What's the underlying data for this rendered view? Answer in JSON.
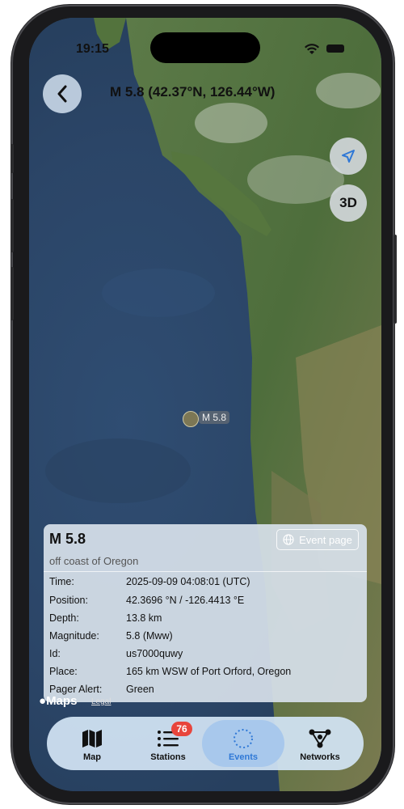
{
  "status": {
    "time": "19:15"
  },
  "header": {
    "title": "M 5.8 (42.37°N, 126.44°W)",
    "back_icon": "chevron-left-icon"
  },
  "map_controls": {
    "location_icon": "location-arrow-icon",
    "three_d_label": "3D"
  },
  "marker": {
    "label": "M 5.8"
  },
  "event": {
    "title": "M 5.8",
    "region": "off coast of Oregon",
    "event_page_label": "Event page",
    "details": [
      {
        "key": "Time:",
        "value": "2025-09-09 04:08:01 (UTC)"
      },
      {
        "key": "Position:",
        "value": "42.3696 °N / -126.4413 °E"
      },
      {
        "key": "Depth:",
        "value": "13.8 km"
      },
      {
        "key": "Magnitude:",
        "value": "5.8 (Mww)"
      },
      {
        "key": "Id:",
        "value": "us7000quwy"
      },
      {
        "key": "Place:",
        "value": "165 km WSW of Port Orford, Oregon"
      },
      {
        "key": "Pager Alert:",
        "value": "Green"
      }
    ]
  },
  "attribution": {
    "maps": "Maps",
    "legal": "Legal"
  },
  "tabs": [
    {
      "label": "Map",
      "icon": "map-icon"
    },
    {
      "label": "Stations",
      "icon": "list-icon",
      "badge": "76"
    },
    {
      "label": "Events",
      "icon": "events-dotted-circle-icon"
    },
    {
      "label": "Networks",
      "icon": "network-icon"
    }
  ],
  "colors": {
    "accent": "#2f78d6",
    "badge": "#e8453c"
  }
}
